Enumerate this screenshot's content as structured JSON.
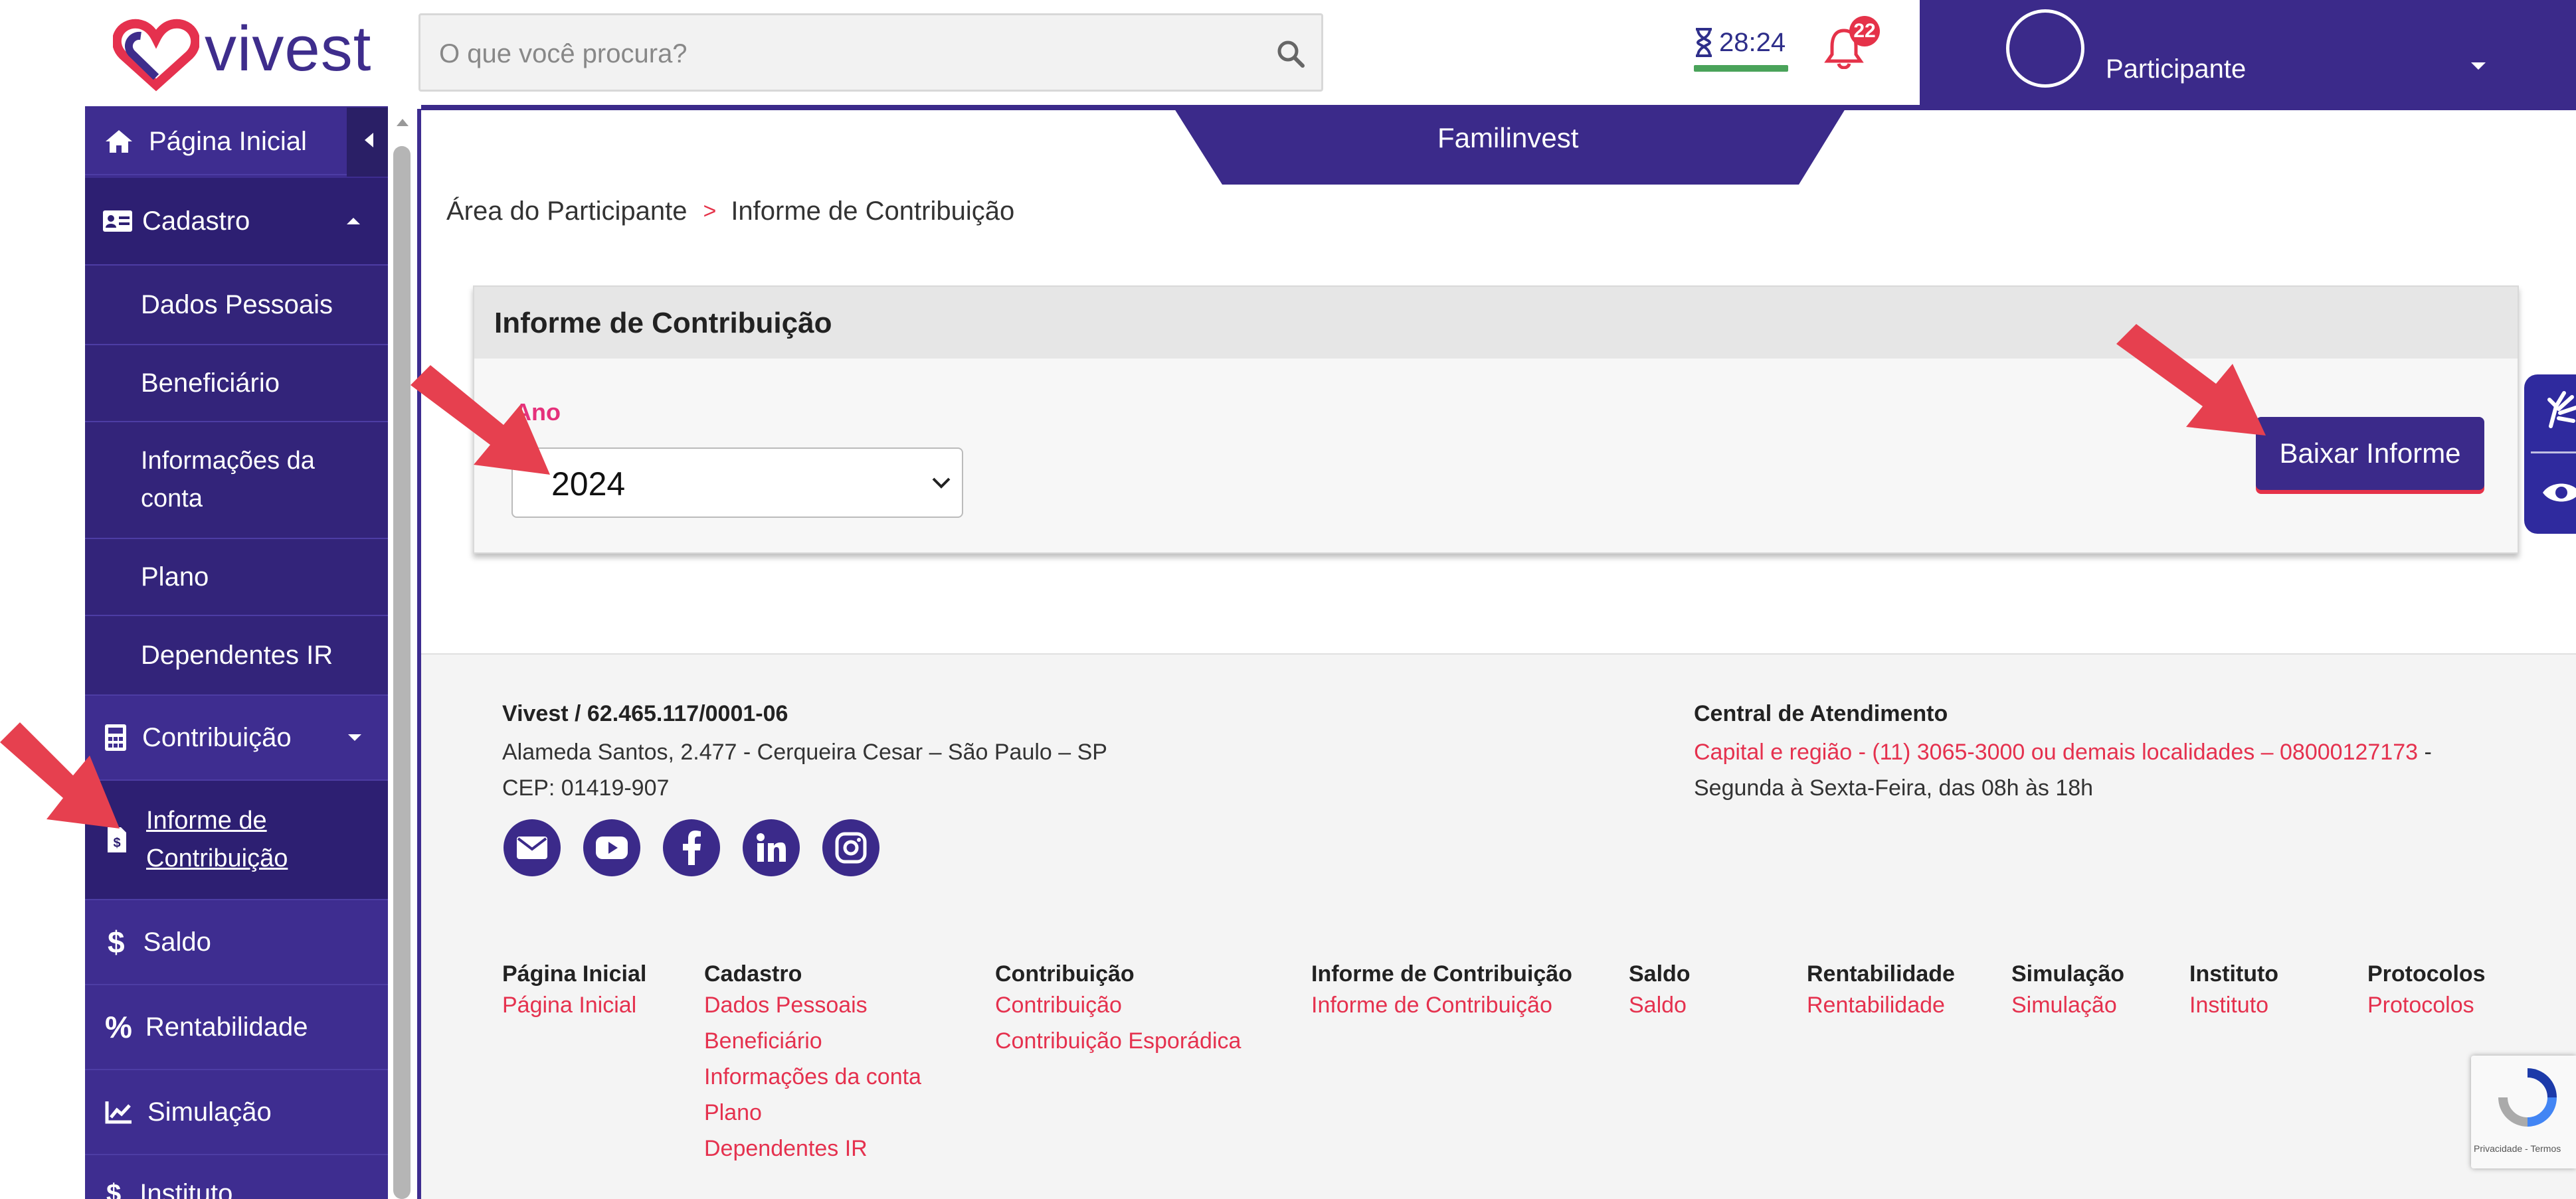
{
  "brand": {
    "name": "vivest"
  },
  "search": {
    "placeholder": "O que você procura?"
  },
  "session": {
    "timer": "28:24",
    "notification_count": "22"
  },
  "user": {
    "role": "Participante"
  },
  "tab": {
    "label": "Familinvest"
  },
  "breadcrumb": {
    "root": "Área do Participante",
    "separator": ">",
    "current": "Informe de Contribuição"
  },
  "sidebar": {
    "home": "Página Inicial",
    "cadastro": "Cadastro",
    "cadastro_items": [
      "Dados Pessoais",
      "Beneficiário",
      "Informações da conta",
      "Plano",
      "Dependentes IR"
    ],
    "contribuicao": "Contribuição",
    "informe_line1": "Informe de",
    "informe_line2": "Contribuição",
    "saldo": "Saldo",
    "rentabilidade": "Rentabilidade",
    "simulacao": "Simulação",
    "instituto": "Instituto"
  },
  "card": {
    "title": "Informe de Contribuição",
    "year_label": "Ano",
    "year_value": "2024",
    "download_button": "Baixar Informe"
  },
  "footer": {
    "company": "Vivest / 62.465.117/0001-06",
    "address": "Alameda Santos, 2.477 - Cerqueira Cesar – São Paulo – SP",
    "cep": "CEP: 01419-907",
    "central_title": "Central de Atendimento",
    "central_phone": "Capital e região - (11) 3065-3000 ou demais localidades – 08000127173",
    "central_dash": " -",
    "central_hours": "Segunda à Sexta-Feira, das 08h às 18h",
    "social_icons": [
      "email-icon",
      "youtube-icon",
      "facebook-icon",
      "linkedin-icon",
      "instagram-icon"
    ],
    "columns": [
      {
        "title": "Página Inicial",
        "links": [
          "Página Inicial"
        ]
      },
      {
        "title": "Cadastro",
        "links": [
          "Dados Pessoais",
          "Beneficiário",
          "Informações da conta",
          "Plano",
          "Dependentes IR"
        ]
      },
      {
        "title": "Contribuição",
        "links": [
          "Contribuição",
          "Contribuição Esporádica"
        ]
      },
      {
        "title": "Informe de Contribuição",
        "links": [
          "Informe de Contribuição"
        ]
      },
      {
        "title": "Saldo",
        "links": [
          "Saldo"
        ]
      },
      {
        "title": "Rentabilidade",
        "links": [
          "Rentabilidade"
        ]
      },
      {
        "title": "Simulação",
        "links": [
          "Simulação"
        ]
      },
      {
        "title": "Instituto",
        "links": [
          "Instituto"
        ]
      },
      {
        "title": "Protocolos",
        "links": [
          "Protocolos"
        ]
      }
    ]
  },
  "recaptcha": {
    "text": "Privacidade - Termos"
  },
  "colors": {
    "primary": "#3b2a8a",
    "accent": "#e53249",
    "pink_label": "#e5317b"
  }
}
